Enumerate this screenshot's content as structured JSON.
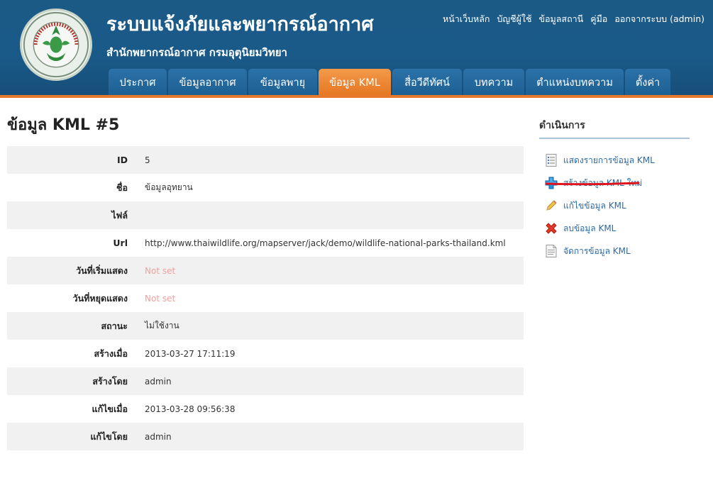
{
  "header": {
    "site_title": "ระบบแจ้งภัยและพยากรณ์อากาศ",
    "site_subtitle": "สำนักพยากรณ์อากาศ กรมอุตุนิยมวิทยา",
    "logo_text": "กรมอุตุนิยมวิทยา METEOROLOGICAL DEPARTMENT",
    "top_links": [
      "หน้าเว็บหลัก",
      "บัญชีผู้ใช้",
      "ข้อมูลสถานี",
      "คู่มือ",
      "ออกจากระบบ (admin)"
    ],
    "tabs": [
      "ประกาศ",
      "ข้อมูลอากาศ",
      "ข้อมูลพายุ",
      "ข้อมูล KML",
      "สื่อวีดีทัศน์",
      "บทความ",
      "ตำแหน่งบทความ",
      "ตั้งค่า"
    ],
    "active_tab_index": 3
  },
  "main": {
    "title": "ข้อมูล KML #5",
    "rows": [
      {
        "label": "ID",
        "value": "5",
        "notset": false
      },
      {
        "label": "ชื่อ",
        "value": "ข้อมูลอุทยาน",
        "notset": false
      },
      {
        "label": "ไฟล์",
        "value": "",
        "notset": false
      },
      {
        "label": "Url",
        "value": "http://www.thaiwildlife.org/mapserver/jack/demo/wildlife-national-parks-thailand.kml",
        "notset": false
      },
      {
        "label": "วันที่เริ่มแสดง",
        "value": "Not set",
        "notset": true
      },
      {
        "label": "วันที่หยุดแสดง",
        "value": "Not set",
        "notset": true
      },
      {
        "label": "สถานะ",
        "value": "ไม่ใช้งาน",
        "notset": false
      },
      {
        "label": "สร้างเมื่อ",
        "value": "2013-03-27 17:11:19",
        "notset": false
      },
      {
        "label": "สร้างโดย",
        "value": "admin",
        "notset": false
      },
      {
        "label": "แก้ไขเมื่อ",
        "value": "2013-03-28 09:56:38",
        "notset": false
      },
      {
        "label": "แก้ไขโดย",
        "value": "admin",
        "notset": false
      }
    ]
  },
  "sidebar": {
    "title": "ดำเนินการ",
    "operations": [
      {
        "label": "แสดงรายการข้อมูล KML",
        "icon": "list-icon"
      },
      {
        "label": "สร้างข้อมูล KML ใหม่",
        "icon": "plus-icon"
      },
      {
        "label": "แก้ไขข้อมูล KML",
        "icon": "pencil-icon"
      },
      {
        "label": "ลบข้อมูล KML",
        "icon": "delete-icon"
      },
      {
        "label": "จัดการข้อมูล KML",
        "icon": "document-icon"
      }
    ]
  },
  "colors": {
    "header_blue": "#1a5a89",
    "active_tab_orange": "#ef8a36",
    "link_blue": "#2a6aa8",
    "notset_pink": "#f0a0a0",
    "annotation_red": "#e0141e"
  }
}
